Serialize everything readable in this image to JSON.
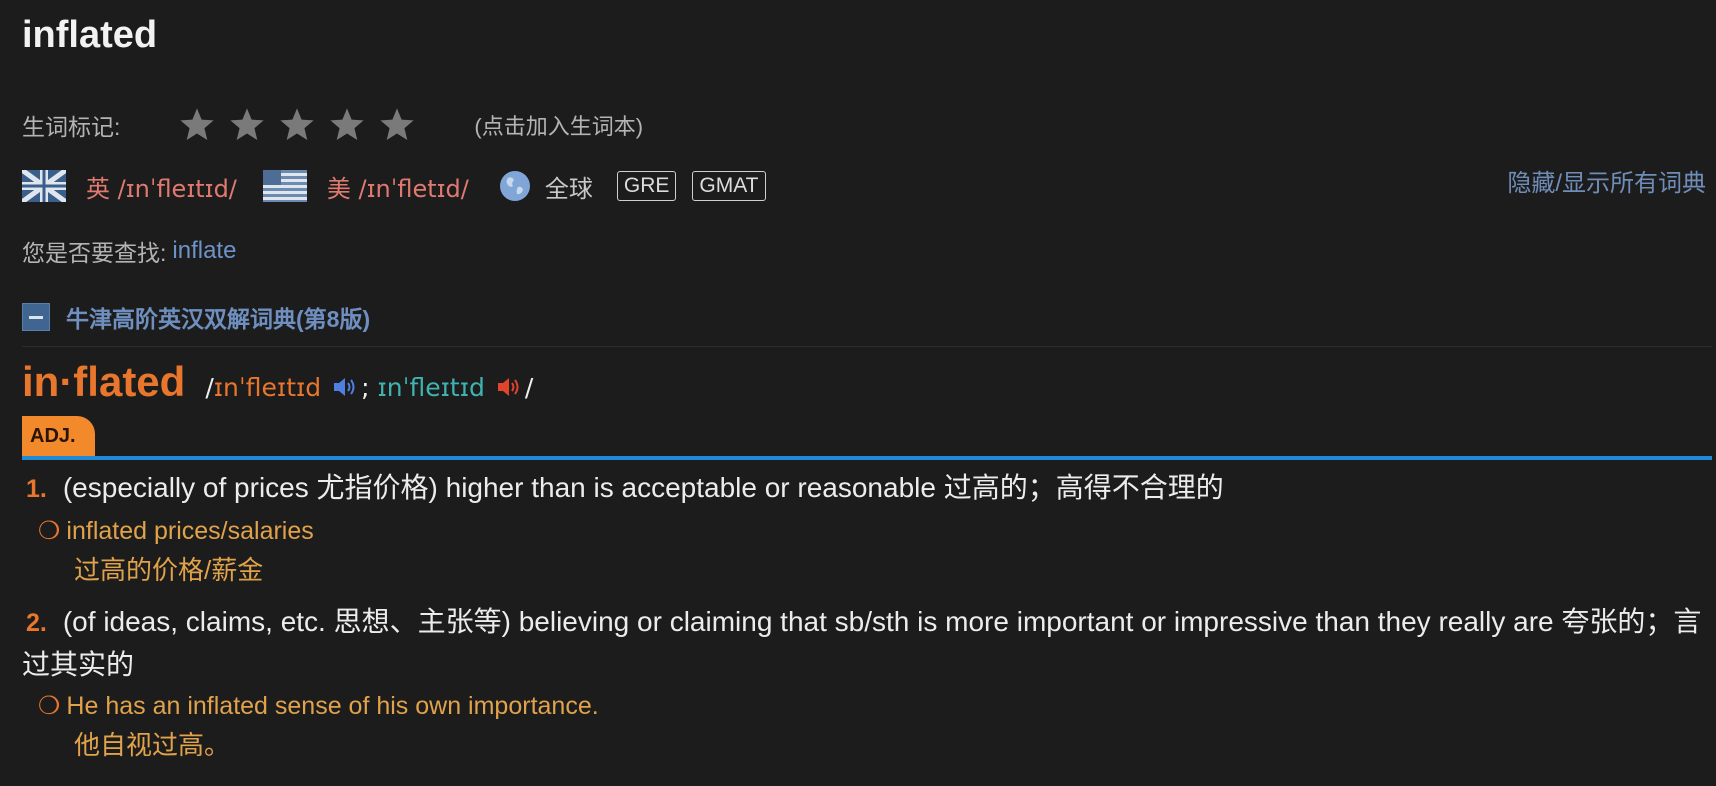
{
  "title": "inflated",
  "wordbook": {
    "label": "生词标记:",
    "star_count": 5,
    "rating": 0,
    "hint": "(点击加入生词本)"
  },
  "pronunciation": {
    "uk_label": "英 /ɪnˈfleɪtɪd/",
    "us_label": "美 /ɪnˈfletɪd/",
    "global_label": "全球",
    "tags": [
      "GRE",
      "GMAT"
    ],
    "toggle_all": "隐藏/显示所有词典"
  },
  "suggest": {
    "label": "您是否要查找:",
    "link": "inflate"
  },
  "dictionary": {
    "name": "牛津高阶英汉双解词典(第8版)",
    "headword": "in·flated",
    "phon_open": "/",
    "phon_br": "ɪnˈfleɪtɪd",
    "phon_sep": ";",
    "phon_am": "ɪnˈfleɪtɪd",
    "phon_close": "/",
    "pos": "ADJ.",
    "senses": [
      {
        "num": "1.",
        "text": "(especially of prices 尤指价格) higher than is acceptable or reasonable 过高的；高得不合理的",
        "example": "inflated prices/salaries",
        "example_translation": "过高的价格/薪金"
      },
      {
        "num": "2.",
        "text": "(of ideas, claims, etc. 思想、主张等) believing or claiming that sb/sth is more important or impressive than they really are 夸张的；言过其实的",
        "example": "He has an inflated sense of his own importance.",
        "example_translation": "他自视过高。"
      }
    ]
  },
  "colors": {
    "background": "#1c1c1c",
    "accent_orange": "#e8762c",
    "example": "#e0a24a",
    "link_blue": "#6f93c8",
    "divider_blue": "#1f8ad6",
    "pron_red": "#e07a70",
    "phon_teal": "#3fb3b0"
  },
  "icons": [
    "star-icon",
    "uk-flag-icon",
    "us-flag-icon",
    "globe-icon",
    "collapse-icon",
    "speaker-icon"
  ]
}
